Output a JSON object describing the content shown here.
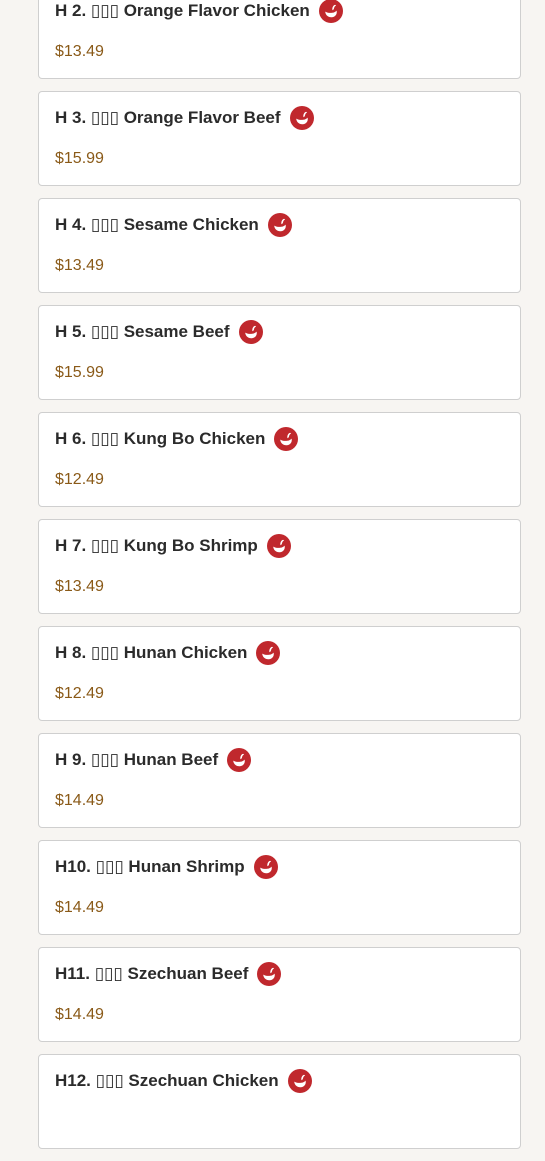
{
  "colors": {
    "background": "#f7f5f2",
    "card_border": "#cfcfcf",
    "title": "#2b2b2b",
    "price": "#8a5a18",
    "spicy_icon": "#c0282d"
  },
  "menu_items": [
    {
      "title": "H 2. ▯▯▯ Orange Flavor Chicken",
      "price": "$13.49",
      "icon": "spicy-pepper-icon"
    },
    {
      "title": "H 3. ▯▯▯ Orange Flavor Beef",
      "price": "$15.99",
      "icon": "spicy-pepper-icon"
    },
    {
      "title": "H 4. ▯▯▯ Sesame Chicken",
      "price": "$13.49",
      "icon": "spicy-pepper-icon"
    },
    {
      "title": "H 5. ▯▯▯ Sesame Beef",
      "price": "$15.99",
      "icon": "spicy-pepper-icon"
    },
    {
      "title": "H 6. ▯▯▯ Kung Bo Chicken",
      "price": "$12.49",
      "icon": "spicy-pepper-icon"
    },
    {
      "title": "H 7. ▯▯▯ Kung Bo Shrimp",
      "price": "$13.49",
      "icon": "spicy-pepper-icon"
    },
    {
      "title": "H 8. ▯▯▯ Hunan Chicken",
      "price": "$12.49",
      "icon": "spicy-pepper-icon"
    },
    {
      "title": "H 9. ▯▯▯ Hunan Beef",
      "price": "$14.49",
      "icon": "spicy-pepper-icon"
    },
    {
      "title": "H10. ▯▯▯ Hunan Shrimp",
      "price": "$14.49",
      "icon": "spicy-pepper-icon"
    },
    {
      "title": "H11. ▯▯▯ Szechuan Beef",
      "price": "$14.49",
      "icon": "spicy-pepper-icon"
    },
    {
      "title": "H12. ▯▯▯ Szechuan Chicken",
      "price": "",
      "icon": "spicy-pepper-icon"
    }
  ]
}
